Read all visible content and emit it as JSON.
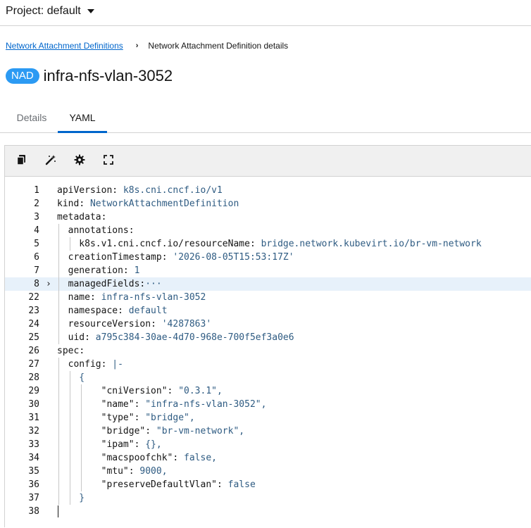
{
  "project": {
    "label": "Project: default"
  },
  "breadcrumb": {
    "link": "Network Attachment Definitions",
    "separator": "›",
    "current": "Network Attachment Definition details"
  },
  "header": {
    "badge": "NAD",
    "title": "infra-nfs-vlan-3052"
  },
  "tabs": [
    {
      "label": "Details"
    },
    {
      "label": "YAML"
    }
  ],
  "toolbar": {
    "icons": [
      "copy-icon",
      "magic-wand-icon",
      "gear-icon",
      "expand-icon"
    ]
  },
  "editor": {
    "lines": [
      {
        "n": "1",
        "k": "apiVersion",
        "sep": ": ",
        "v": "k8s.cni.cncf.io/v1"
      },
      {
        "n": "2",
        "k": "kind",
        "sep": ": ",
        "v": "NetworkAttachmentDefinition"
      },
      {
        "n": "3",
        "k": "metadata",
        "sep": ":",
        "v": ""
      },
      {
        "n": "4",
        "k": "  annotations",
        "sep": ":",
        "v": ""
      },
      {
        "n": "5",
        "k": "    k8s.v1.cni.cncf.io/resourceName",
        "sep": ": ",
        "v": "bridge.network.kubevirt.io/br-vm-network"
      },
      {
        "n": "6",
        "k": "  creationTimestamp",
        "sep": ": ",
        "v": "'2026-08-05T15:53:17Z'"
      },
      {
        "n": "7",
        "k": "  generation",
        "sep": ": ",
        "v": "1"
      },
      {
        "n": "8",
        "k": "  managedFields",
        "sep": ":",
        "v": "···"
      },
      {
        "n": "22",
        "k": "  name",
        "sep": ": ",
        "v": "infra-nfs-vlan-3052"
      },
      {
        "n": "23",
        "k": "  namespace",
        "sep": ": ",
        "v": "default"
      },
      {
        "n": "24",
        "k": "  resourceVersion",
        "sep": ": ",
        "v": "'4287863'"
      },
      {
        "n": "25",
        "k": "  uid",
        "sep": ": ",
        "v": "a795c384-30ae-4d70-968e-700f5ef3a0e6"
      },
      {
        "n": "26",
        "k": "spec",
        "sep": ":",
        "v": ""
      },
      {
        "n": "27",
        "k": "  config",
        "sep": ": ",
        "v": "|-"
      },
      {
        "n": "28",
        "k": "",
        "sep": "",
        "v": "    {"
      },
      {
        "n": "29",
        "k": "        \"cniVersion\"",
        "sep": ": ",
        "v": "\"0.3.1\","
      },
      {
        "n": "30",
        "k": "        \"name\"",
        "sep": ": ",
        "v": "\"infra-nfs-vlan-3052\","
      },
      {
        "n": "31",
        "k": "        \"type\"",
        "sep": ": ",
        "v": "\"bridge\","
      },
      {
        "n": "32",
        "k": "        \"bridge\"",
        "sep": ": ",
        "v": "\"br-vm-network\","
      },
      {
        "n": "33",
        "k": "        \"ipam\"",
        "sep": ": ",
        "v": "{},"
      },
      {
        "n": "34",
        "k": "        \"macspoofchk\"",
        "sep": ": ",
        "v": "false,"
      },
      {
        "n": "35",
        "k": "        \"mtu\"",
        "sep": ": ",
        "v": "9000,"
      },
      {
        "n": "36",
        "k": "        \"preserveDefaultVlan\"",
        "sep": ": ",
        "v": "false"
      },
      {
        "n": "37",
        "k": "",
        "sep": "",
        "v": "    }"
      },
      {
        "n": "38",
        "k": "",
        "sep": "",
        "v": ""
      }
    ],
    "folded_line": "8",
    "fold_marker": "›"
  }
}
